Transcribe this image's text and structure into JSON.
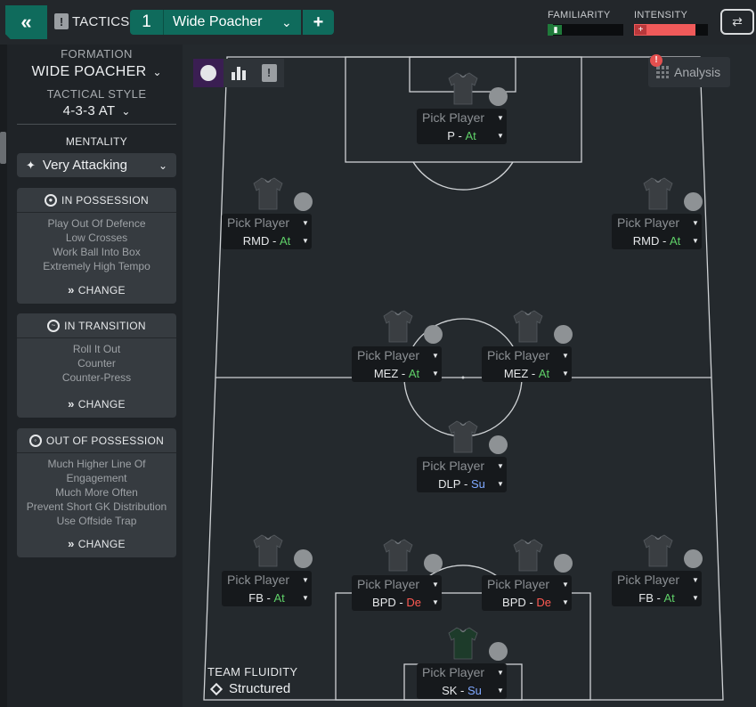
{
  "header": {
    "tactics_label": "TACTICS",
    "tactic_number": "1",
    "tactic_name": "Wide Poacher",
    "familiarity_label": "FAMILIARITY",
    "intensity_label": "INTENSITY",
    "familiarity_level": 0.07,
    "intensity_level": 0.83,
    "familiarity_color": "#1f7a3a",
    "intensity_color": "#f05a5a"
  },
  "panel": {
    "formation_caption": "FORMATION",
    "formation_value": "WIDE POACHER",
    "style_caption": "TACTICAL STYLE",
    "style_value": "4-3-3 AT",
    "mentality_caption": "MENTALITY",
    "mentality_value": "Very Attacking",
    "in_possession": {
      "title": "IN POSSESSION",
      "items": [
        "Play Out Of Defence",
        "Low Crosses",
        "Work Ball Into Box",
        "Extremely High Tempo"
      ],
      "change": "CHANGE"
    },
    "in_transition": {
      "title": "IN TRANSITION",
      "items": [
        "Roll It Out",
        "Counter",
        "Counter-Press"
      ],
      "change": "CHANGE"
    },
    "out_of_possession": {
      "title": "OUT OF POSSESSION",
      "items": [
        "Much Higher Line Of",
        "Engagement",
        "Much More Often",
        "Prevent Short GK Distribution",
        "Use Offside Trap"
      ],
      "change": "CHANGE"
    }
  },
  "analysis": {
    "label": "Analysis",
    "alert": "!"
  },
  "slots": {
    "p": {
      "pick": "Pick Player",
      "role": "P",
      "duty": "At"
    },
    "rmdl": {
      "pick": "Pick Player",
      "role": "RMD",
      "duty": "At"
    },
    "rmdr": {
      "pick": "Pick Player",
      "role": "RMD",
      "duty": "At"
    },
    "mezl": {
      "pick": "Pick Player",
      "role": "MEZ",
      "duty": "At"
    },
    "mezr": {
      "pick": "Pick Player",
      "role": "MEZ",
      "duty": "At"
    },
    "dlp": {
      "pick": "Pick Player",
      "role": "DLP",
      "duty": "Su"
    },
    "fbl": {
      "pick": "Pick Player",
      "role": "FB",
      "duty": "At"
    },
    "bpdl": {
      "pick": "Pick Player",
      "role": "BPD",
      "duty": "De"
    },
    "bpdr": {
      "pick": "Pick Player",
      "role": "BPD",
      "duty": "De"
    },
    "fbr": {
      "pick": "Pick Player",
      "role": "FB",
      "duty": "At"
    },
    "sk": {
      "pick": "Pick Player",
      "role": "SK",
      "duty": "Su"
    }
  },
  "fluidity": {
    "caption": "TEAM FLUIDITY",
    "value": "Structured"
  },
  "colors": {
    "accent": "#0f6b5c",
    "attack_duty": "#5fd068",
    "support_duty": "#7fa8ff",
    "defend_duty": "#ff5a52"
  },
  "icons": {
    "back": "double-chevron-left-icon",
    "shirt": "shirt-icon",
    "goalkeeper_shirt": "goalkeeper-shirt-icon",
    "condition": "condition-dot-icon"
  }
}
